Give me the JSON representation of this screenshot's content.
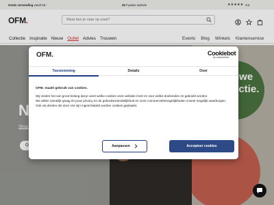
{
  "topbar": {
    "shipping_bold": "Gratis verzending",
    "shipping_rest": " vanaf 50,-",
    "stores_bold": "25",
    "stores_rest": " Fysieke winkels",
    "rating_stars": "★★★★★",
    "rating_value": "8,6"
  },
  "header": {
    "logo": "OFM",
    "logo_dot": ".",
    "search_placeholder": "Waar ben je naar op zoek?",
    "icons": [
      "account-icon",
      "wishlist-star-icon",
      "cart-bag-icon"
    ]
  },
  "nav": {
    "left": [
      "Collectie",
      "Inspiratie",
      "Nieuw",
      "Outlet",
      "Advies",
      "Trouwen"
    ],
    "right": [
      "Events",
      "Blog",
      "Winkels",
      "Klantenservice"
    ]
  },
  "hero": {
    "headline_fragment": "N",
    "shop_link": "Shop d",
    "button_fragment": "Ove",
    "promo_circle_text": "nwe\nectie."
  },
  "cookie_dialog": {
    "logo": "OFM.",
    "brand_name": "Cookiebot",
    "brand_sub": "by Usercentrics",
    "tabs": [
      "Toestemming",
      "Details",
      "Over"
    ],
    "active_tab": 0,
    "heading": "OFM. maakt gebruik van cookies.",
    "paragraphs": [
      "Wij vinden het van groot belang dat je weet welke cookies onze website inzet en voor welke doeleinden ze gebruikt worden.",
      "We willen namelijk graag én jouw privacy én de gebruiksvriendelijkheid en onze commerciëlemogelijkheden zoveel mogelijk waarborgen.",
      "Ook via derden die door ons zijn ingeschakeld worden cookies geplaatst."
    ],
    "customize_button": "Aanpassen",
    "accept_button": "Accepteer cookies"
  },
  "colors": {
    "accent_blue": "#2d4a86",
    "outlet_red": "#d32f2f",
    "logo_dot": "#d4471a"
  }
}
